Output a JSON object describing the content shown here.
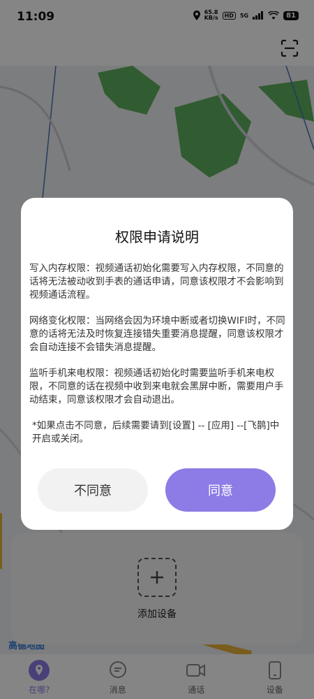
{
  "status_bar": {
    "time": "11:09",
    "speed_value": "65.8",
    "speed_unit": "KB/s",
    "hd": "HD",
    "network": "5G",
    "battery": "81"
  },
  "dialog": {
    "title": "权限申请说明",
    "paragraphs": [
      "写入内存权限：视频通话初始化需要写入内存权限，不同意的话将无法被动收到手表的通话申请，同意该权限才不会影响到视频通话流程。",
      "网络变化权限：当网络会因为环境中断或者切换WIFI时，不同意的话将无法及时恢复连接错失重要消息提醒，同意该权限才会自动连接不会错失消息提醒。",
      "监听手机来电权限：视频通话初始化时需要监听手机来电权限，不同意的话在视频中收到来电就会黑屏中断，需要用户手动结束，同意该权限才会自动退出。",
      "*如果点击不同意，后续需要请到[设置] -- [应用] --[飞鹊]中开启或关闭。"
    ],
    "disagree_label": "不同意",
    "agree_label": "同意"
  },
  "device_panel": {
    "add_label": "添加设备"
  },
  "map": {
    "logo": "高德地图"
  },
  "bottom_nav": {
    "items": [
      {
        "label": "在哪?",
        "icon": "location-icon",
        "active": true
      },
      {
        "label": "消息",
        "icon": "message-icon",
        "active": false
      },
      {
        "label": "通话",
        "icon": "video-call-icon",
        "active": false
      },
      {
        "label": "设备",
        "icon": "phone-device-icon",
        "active": false
      }
    ]
  },
  "colors": {
    "accent": "#8d7be6",
    "map_green": "#5fae5f",
    "map_road": "#e8b23a"
  }
}
